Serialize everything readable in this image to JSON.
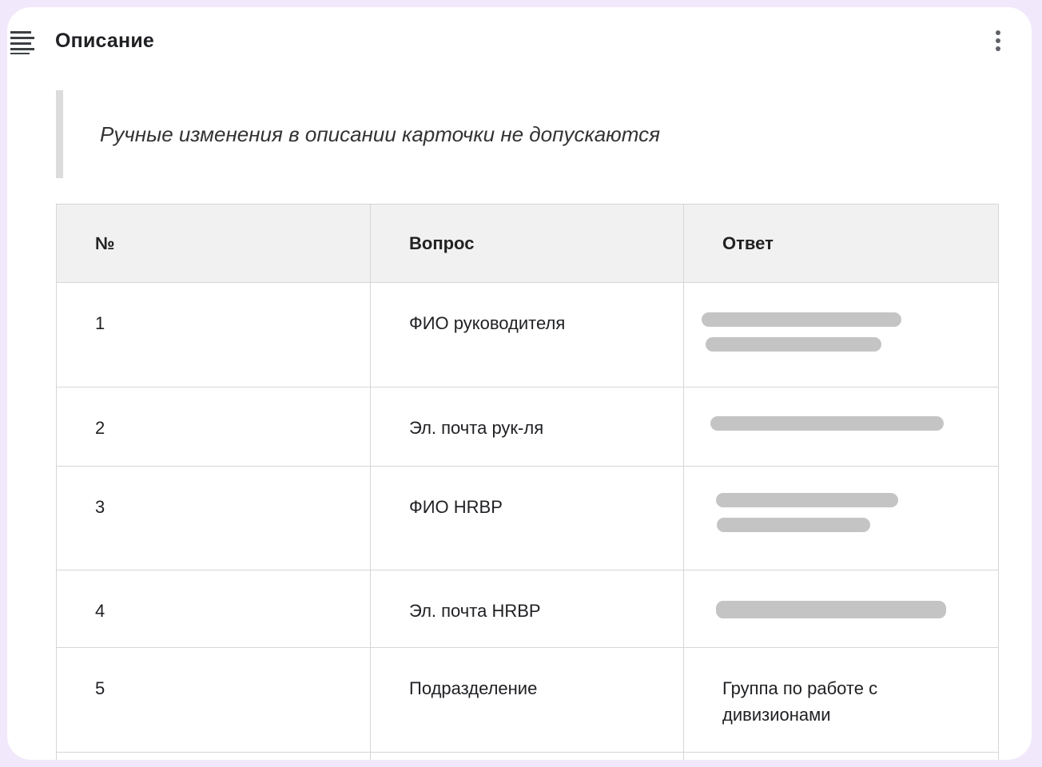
{
  "header": {
    "title": "Описание",
    "icon": "notes-icon",
    "menu_icon": "more-vertical-icon"
  },
  "notice": {
    "text": "Ручные изменения в описании карточки не допускаются"
  },
  "table": {
    "columns": [
      "№",
      "Вопрос",
      "Ответ"
    ],
    "rows": [
      {
        "number": "1",
        "question": "ФИО руководителя",
        "answer": "",
        "answer_redacted": true
      },
      {
        "number": "2",
        "question": "Эл. почта рук-ля",
        "answer": "",
        "answer_redacted": true
      },
      {
        "number": "3",
        "question": "ФИО HRBP",
        "answer": "",
        "answer_redacted": true
      },
      {
        "number": "4",
        "question": "Эл. почта HRBP",
        "answer": "",
        "answer_redacted": true
      },
      {
        "number": "5",
        "question": "Подразделение",
        "answer": "Группа по работе с дивизионами",
        "answer_redacted": false
      }
    ]
  },
  "colors": {
    "background": "#f1e9fb",
    "card": "#ffffff",
    "header_row": "#f1f1f1",
    "border": "#d6d6d6",
    "quote_bar": "#dcdcdc",
    "redaction": "#c4c4c4"
  }
}
